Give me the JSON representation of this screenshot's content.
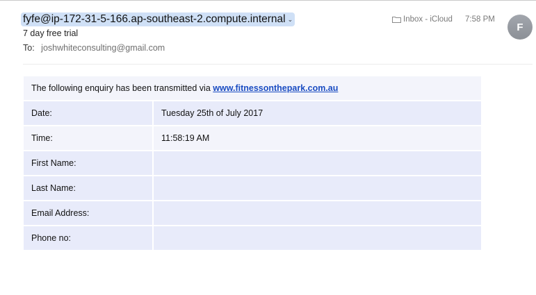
{
  "header": {
    "sender": "fyfe@ip-172-31-5-166.ap-southeast-2.compute.internal",
    "subject": "7 day free trial",
    "to_label": "To:",
    "to_address": "joshwhiteconsulting@gmail.com",
    "mailbox": "Inbox - iCloud",
    "time": "7:58 PM",
    "avatar_initial": "F"
  },
  "body": {
    "intro_text": "The following enquiry has been transmitted via ",
    "intro_link": "www.fitnessonthepark.com.au",
    "rows": [
      {
        "label": "Date:",
        "value": "Tuesday 25th of July 2017"
      },
      {
        "label": "Time:",
        "value": "11:58:19 AM"
      },
      {
        "label": "First Name:",
        "value": ""
      },
      {
        "label": "Last Name:",
        "value": ""
      },
      {
        "label": "Email Address:",
        "value": ""
      },
      {
        "label": "Phone no:",
        "value": ""
      }
    ]
  }
}
